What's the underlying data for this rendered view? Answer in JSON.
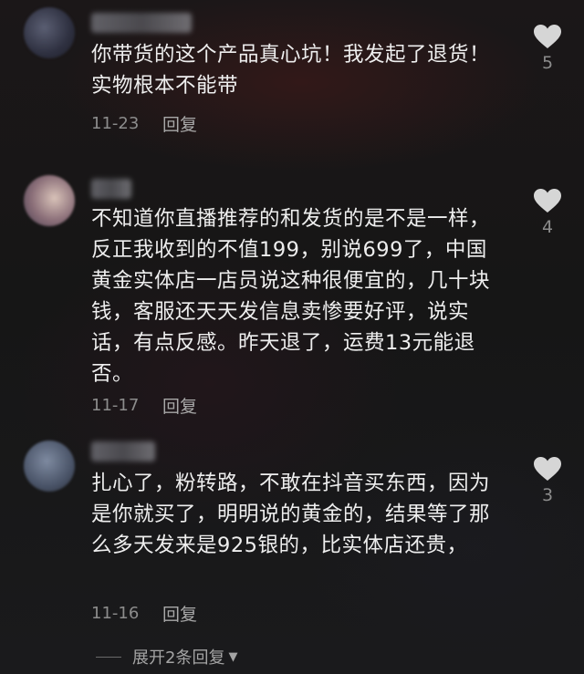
{
  "comments": [
    {
      "text": "你带货的这个产品真心坑！我发起了退货！实物根本不能带",
      "date": "11-23",
      "reply_label": "回复",
      "likes": "5"
    },
    {
      "text": "不知道你直播推荐的和发货的是不是一样，反正我收到的不值199，别说699了，中国黄金实体店一店员说这种很便宜的，几十块钱，客服还天天发信息卖惨要好评，说实话，有点反感。昨天退了，运费13元能退否。",
      "date": "11-17",
      "reply_label": "回复",
      "likes": "4"
    },
    {
      "text": "扎心了，粉转路，不敢在抖音买东西，因为是你就买了，明明说的黄金的，结果等了那么多天发来是925银的，比实体店还贵，",
      "date": "11-16",
      "reply_label": "回复",
      "likes": "3"
    }
  ],
  "expand_replies": {
    "label": "展开2条回复"
  },
  "icons": {
    "like": "heart-icon",
    "expand": "triangle-down-icon"
  },
  "colors": {
    "text": "#eeeeee",
    "meta": "#8c8c8c",
    "heart": "#d6d6d6"
  }
}
